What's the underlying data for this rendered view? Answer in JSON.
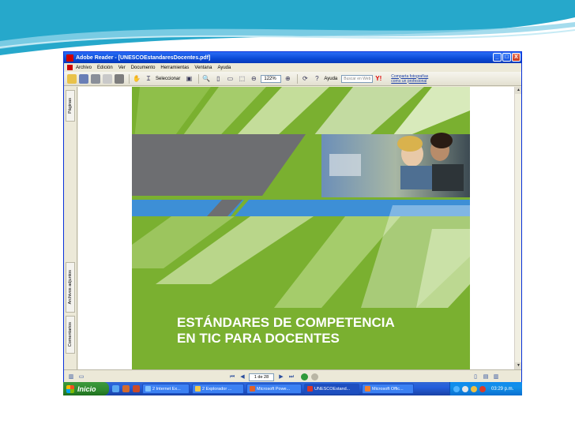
{
  "window": {
    "title": "Adobe Reader - [UNESCOEstandaresDocentes.pdf]",
    "controls": [
      "_",
      "□",
      "X"
    ]
  },
  "menu": [
    "Archivo",
    "Edición",
    "Ver",
    "Documento",
    "Herramientas",
    "Ventana",
    "Ayuda"
  ],
  "toolbar": {
    "select_label": "Seleccionar",
    "zoom_value": "122%",
    "help_label": "Ayuda",
    "search_placeholder": "Buscar en Web",
    "yahoo_label": "Y!",
    "promo_line1": "Comparta fotografías",
    "promo_line2": "como un profesional"
  },
  "nav_tabs": [
    "Páginas",
    "Archivos adjuntos",
    "Comentarios"
  ],
  "document": {
    "heading_line1": "ESTÁNDARES DE COMPETENCIA",
    "heading_line2": "EN TIC PARA DOCENTES"
  },
  "statusbar": {
    "page_indicator": "1 de 28"
  },
  "taskbar": {
    "start_label": "Inicio",
    "tasks": [
      "2 Internet Ex...",
      "2 Explorador ...",
      "Microsoft Powe...",
      "UNESCOEstand...",
      "Microsoft Offic..."
    ],
    "clock": "03:29 p.m."
  },
  "colors": {
    "slide_teal": "#1aa3c8",
    "doc_green": "#7ab030",
    "doc_blue": "#3d8fd6",
    "doc_gray": "#6d6e71",
    "xp_blue": "#245edb",
    "xp_start_green": "#2f8a2f"
  }
}
